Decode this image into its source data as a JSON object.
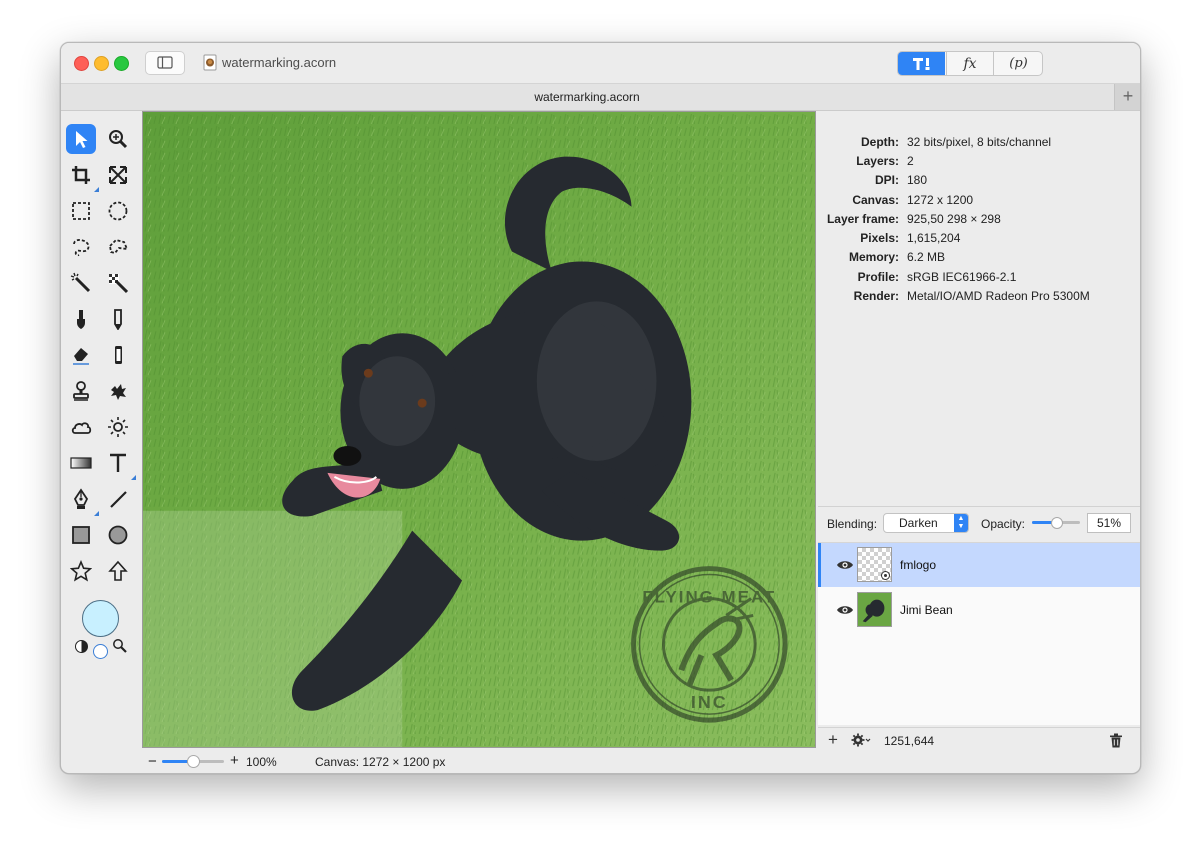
{
  "window": {
    "title": "watermarking.acorn",
    "tab_title": "watermarking.acorn"
  },
  "toolbar_segments": {
    "tools": "tools-icon",
    "fx_label": "fx",
    "p_label": "(p)"
  },
  "tools": {
    "selected": "move-tool",
    "items": [
      "move-tool",
      "zoom-tool",
      "crop-tool",
      "transform-tool",
      "rect-select-tool",
      "ellipse-select-tool",
      "lasso-tool",
      "polygon-lasso-tool",
      "magic-wand-tool",
      "color-select-tool",
      "brush-tool",
      "pencil-tool",
      "eraser-tool",
      "fill-tool",
      "clone-tool",
      "smudge-tool",
      "burn-tool",
      "dodge-tool",
      "gradient-tool",
      "text-tool",
      "pen-tool",
      "line-tool",
      "rectangle-tool",
      "oval-tool",
      "star-tool",
      "arrow-tool"
    ]
  },
  "colors": {
    "accent": "#2f84f5",
    "foreground_swatch": "#c8f0ff",
    "selected_layer_bg": "#c4d8fe"
  },
  "statusbar": {
    "zoom_minus": "−",
    "zoom_plus": "+",
    "zoom_level": "100%",
    "zoom_fraction": 0.5,
    "canvas_info": "Canvas: 1272 × 1200 px"
  },
  "info": [
    {
      "key": "Depth:",
      "value": "32 bits/pixel, 8 bits/channel"
    },
    {
      "key": "Layers:",
      "value": "2"
    },
    {
      "key": "DPI:",
      "value": "180"
    },
    {
      "key": "Canvas:",
      "value": "1272 x 1200"
    },
    {
      "key": "Layer frame:",
      "value": "925,50 298 × 298"
    },
    {
      "key": "Pixels:",
      "value": "1,615,204"
    },
    {
      "key": "Memory:",
      "value": "6.2 MB"
    },
    {
      "key": "Profile:",
      "value": "sRGB IEC61966-2.1"
    },
    {
      "key": "Render:",
      "value": "Metal/IO/AMD Radeon Pro 5300M"
    }
  ],
  "layers_panel": {
    "blending_label": "Blending:",
    "blending_value": "Darken",
    "opacity_label": "Opacity:",
    "opacity_value": "51%",
    "opacity_fraction": 0.51,
    "layers": [
      {
        "name": "fmlogo",
        "selected": true
      },
      {
        "name": "Jimi Bean",
        "selected": false
      }
    ],
    "footer_add": "+",
    "footer_coords": "1251,644"
  },
  "watermark": {
    "top_text": "FLYING MEAT",
    "bottom_text": "INC"
  }
}
